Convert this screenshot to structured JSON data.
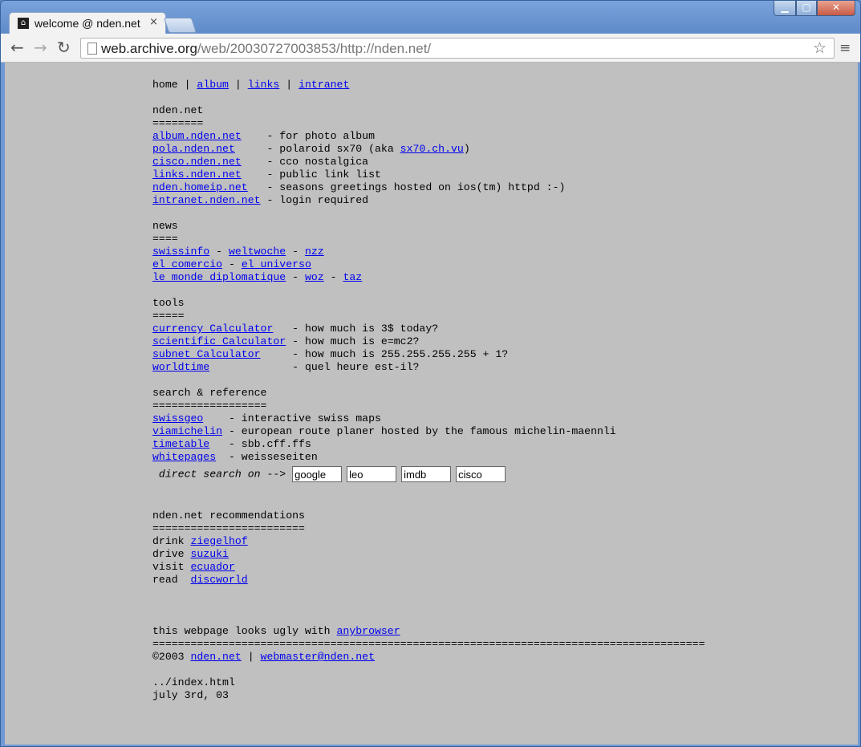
{
  "browser": {
    "tab_title": "welcome @ nden.net",
    "tab_close": "×",
    "url_host": "web.archive.org",
    "url_path": "/web/20030727003853/http://nden.net/",
    "window_buttons": {
      "minimize": "▁",
      "maximize": "▢",
      "close": "✕"
    },
    "nav": {
      "back": "←",
      "forward": "→",
      "reload": "↻",
      "star": "☆",
      "menu": "≡"
    }
  },
  "page": {
    "topnav": {
      "home": "home",
      "sep": " | ",
      "album": "album",
      "links": "links",
      "intranet": "intranet"
    },
    "sites": {
      "title": "nden.net",
      "underline": "========",
      "rows": [
        {
          "link": "album.nden.net",
          "pad": "    ",
          "desc": "- for photo album"
        },
        {
          "link": "pola.nden.net",
          "pad": "     ",
          "desc": "- polaroid sx70 (aka ",
          "link2": "sx70.ch.vu",
          "desc2": ")"
        },
        {
          "link": "cisco.nden.net",
          "pad": "    ",
          "desc": "- cco nostalgica"
        },
        {
          "link": "links.nden.net",
          "pad": "    ",
          "desc": "- public link list"
        },
        {
          "link": "nden.homeip.net",
          "pad": "   ",
          "desc": "- seasons greetings hosted on ios(tm) httpd :-)"
        },
        {
          "link": "intranet.nden.net",
          "pad": " ",
          "desc": "- login required"
        }
      ]
    },
    "news": {
      "title": "news",
      "underline": "====",
      "dash": " - ",
      "row1": [
        "swissinfo",
        "weltwoche",
        "nzz"
      ],
      "row2": [
        "el comercio",
        "el universo"
      ],
      "row3": [
        "le monde diplomatique",
        "woz",
        "taz"
      ]
    },
    "tools": {
      "title": "tools",
      "underline": "=====",
      "rows": [
        {
          "link": "currency Calculator",
          "pad": "   ",
          "desc": "- how much is 3$ today?"
        },
        {
          "link": "scientific Calculator",
          "pad": " ",
          "desc": "- how much is e=mc2?"
        },
        {
          "link": "subnet Calculator",
          "pad": "     ",
          "desc": "- how much is 255.255.255.255 + 1?"
        },
        {
          "link": "worldtime",
          "pad": "             ",
          "desc": "- quel heure est-il?"
        }
      ]
    },
    "search": {
      "title": "search & reference",
      "underline": "==================",
      "rows": [
        {
          "link": "swissgeo",
          "pad": "    ",
          "desc": "- interactive swiss maps"
        },
        {
          "link": "viamichelin",
          "pad": " ",
          "desc": "- european route planer hosted by the famous michelin-maennli"
        },
        {
          "link": "timetable",
          "pad": "   ",
          "desc": "- sbb.cff.ffs"
        },
        {
          "link": "whitepages",
          "pad": "  ",
          "desc": "- weisseseiten"
        }
      ],
      "direct_label": " direct search on --> ",
      "inputs": [
        "google",
        "leo",
        "imdb",
        "cisco"
      ]
    },
    "recommendations": {
      "title": "nden.net recommendations",
      "underline": "========================",
      "rows": [
        {
          "verb": "drink ",
          "link": "ziegelhof"
        },
        {
          "verb": "drive ",
          "link": "suzuki"
        },
        {
          "verb": "visit ",
          "link": "ecuador"
        },
        {
          "verb": "read  ",
          "link": "discworld"
        }
      ]
    },
    "footer": {
      "ugly_text": "this webpage looks ugly with ",
      "ugly_link": "anybrowser",
      "rule": "=======================================================================================",
      "copyright": "©2003 ",
      "site_link": "nden.net",
      "sep": " | ",
      "mail_link": "webmaster@nden.net",
      "path": "../index.html",
      "date": "july 3rd, 03"
    }
  }
}
